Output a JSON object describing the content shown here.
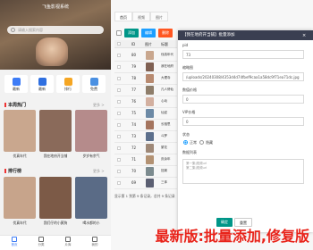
{
  "app": {
    "title": "飞鱼影视系统",
    "search_placeholder": "请输入搜索内容",
    "categories": [
      {
        "label": "最新",
        "color": "#3d7cf6"
      },
      {
        "label": "最新",
        "color": "#2f6fe0"
      },
      {
        "label": "排行",
        "color": "#f5a623"
      },
      {
        "label": "免费",
        "color": "#4a90e2"
      }
    ],
    "section_hot": {
      "title": "本周热门",
      "more": "更多 >"
    },
    "hot_items": [
      {
        "label": "伐真年代",
        "color": "#c9a78e"
      },
      {
        "label": "我在地府开当铺",
        "color": "#8a6a5a"
      },
      {
        "label": "岁岁有余气",
        "color": "#b58b8b"
      }
    ],
    "section_rank": {
      "title": "排行榜",
      "more": "更多 >"
    },
    "rank_items": [
      {
        "label": "伐真年代",
        "color": "#c7a48b"
      },
      {
        "label": "我们仔的小黄狗",
        "color": "#7c5a47"
      },
      {
        "label": "喝水都的小",
        "color": "#5a6b86"
      }
    ],
    "tabbar": [
      "首页",
      "分类",
      "片库",
      "我的"
    ]
  },
  "admin": {
    "tabs": [
      "首页",
      "视频",
      "图片"
    ],
    "toolbar": [
      {
        "label": "添加",
        "color": "#009688"
      },
      {
        "label": "编辑",
        "color": "#1e9fff"
      },
      {
        "label": "删除",
        "color": "#ff5722"
      }
    ],
    "table_headers": [
      "ID",
      "图片",
      "标题"
    ],
    "rows": [
      {
        "id": "80",
        "title": "伐真年代",
        "color": "#c9a78e"
      },
      {
        "id": "79",
        "title": "我在地府",
        "color": "#7f6052"
      },
      {
        "id": "78",
        "title": "大理寺",
        "color": "#b88a70"
      },
      {
        "id": "77",
        "title": "凡人修仙",
        "color": "#8e7d6a"
      },
      {
        "id": "76",
        "title": "心动",
        "color": "#d3b0a0"
      },
      {
        "id": "75",
        "title": "仙逆",
        "color": "#6d8aa6"
      },
      {
        "id": "74",
        "title": "长相思",
        "color": "#a5755f"
      },
      {
        "id": "73",
        "title": "斗罗",
        "color": "#5c6f8c"
      },
      {
        "id": "72",
        "title": "繁花",
        "color": "#9e8877"
      },
      {
        "id": "71",
        "title": "庆余年",
        "color": "#b39273"
      },
      {
        "id": "70",
        "title": "狂飙",
        "color": "#7c8b8f"
      },
      {
        "id": "69",
        "title": "三体",
        "color": "#5b5f72"
      }
    ],
    "footer": "显示第 1 到第 9 条记录，总共 9 条记录"
  },
  "modal": {
    "title": "【我在地府开当铺】批量添加",
    "fields": [
      {
        "label": "pid",
        "value": "73"
      },
      {
        "label": "缩略图",
        "value": "/uploads/20240308/4353d4d74fbef9caa1a58dc9f71ea71dc.jpg"
      },
      {
        "label": "数值价格",
        "value": "0"
      },
      {
        "label": "VIP价格",
        "value": "0"
      }
    ],
    "status_label": "状态",
    "status_options": [
      "正常",
      "隐藏"
    ],
    "desc_label": "数据列表",
    "desc_placeholder": "第一集|视频url\n第二集|视频url",
    "confirm": "确定",
    "reset": "重置"
  },
  "overlay": "最新版:批量添加,修复版"
}
